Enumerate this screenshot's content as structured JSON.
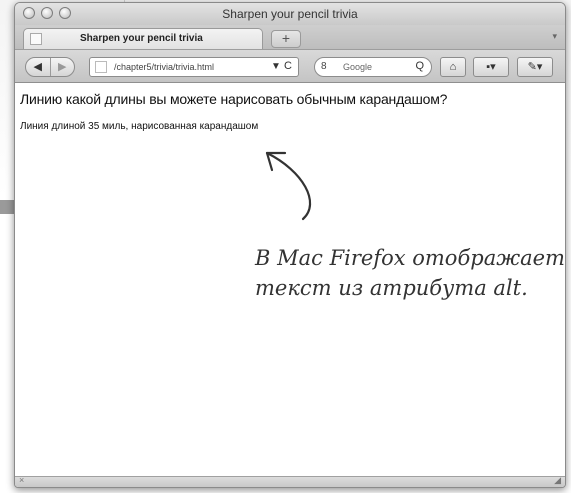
{
  "window": {
    "title": "Sharpen your pencil trivia"
  },
  "tabs": [
    {
      "label": "Sharpen your pencil trivia"
    }
  ],
  "toolbar": {
    "new_tab": "+",
    "back": "◀",
    "forward": "▶",
    "url": "/chapter5/trivia/trivia.html",
    "bookmark_star": "▼",
    "reload": "C",
    "search_engine_badge": "8",
    "search_placeholder": "Google",
    "search_icon": "Q",
    "home": "⌂",
    "tab_menu": "▾"
  },
  "page": {
    "question": "Линию какой длины вы можете нарисовать обычным карандашом?",
    "alt_text": "Линия длиной 35 миль, нарисованная карандашом"
  },
  "annotation": {
    "line1": "В Mac Firefox отображает",
    "line2": "текст из атрибута alt."
  },
  "statusbar": {
    "close_glyph": "×",
    "grip_glyph": "◢"
  },
  "icons": [
    "traffic-light-icon",
    "favicon-icon",
    "back-icon",
    "forward-icon",
    "site-icon",
    "bookmark-star-icon",
    "reload-icon",
    "search-engine-icon",
    "magnifier-icon",
    "home-icon",
    "bookmarks-menu-icon",
    "addons-icon",
    "arrow-icon"
  ]
}
